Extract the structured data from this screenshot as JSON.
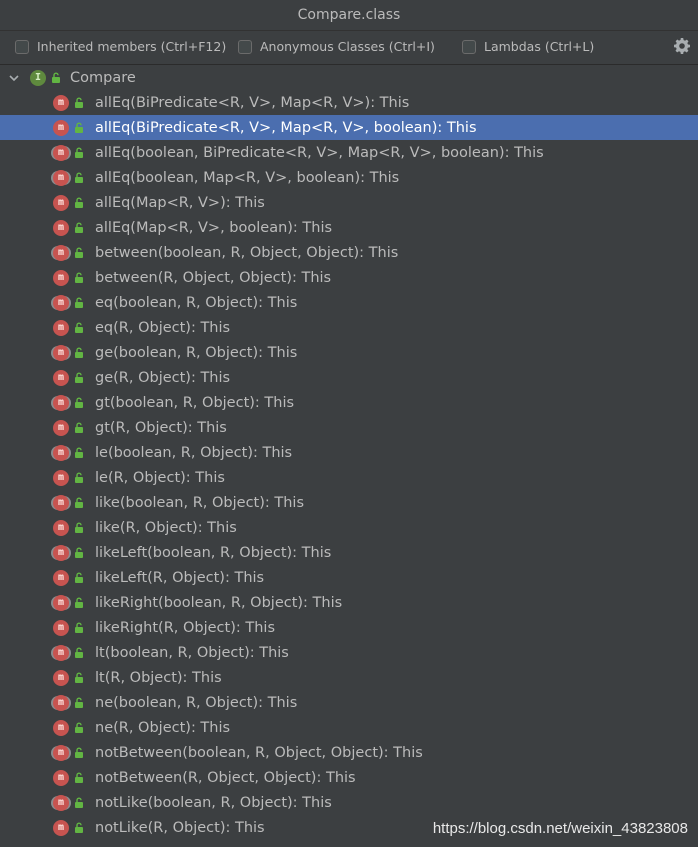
{
  "window": {
    "title": "Compare.class"
  },
  "toolbar": {
    "inherited_label": "Inherited members (Ctrl+F12)",
    "anonymous_label": "Anonymous Classes (Ctrl+I)",
    "lambdas_label": "Lambdas (Ctrl+L)"
  },
  "tree": {
    "root_label": "Compare",
    "methods": [
      "allEq(BiPredicate<R, V>, Map<R, V>): This",
      "allEq(BiPredicate<R, V>, Map<R, V>, boolean): This",
      "allEq(boolean, BiPredicate<R, V>, Map<R, V>, boolean): This",
      "allEq(boolean, Map<R, V>, boolean): This",
      "allEq(Map<R, V>): This",
      "allEq(Map<R, V>, boolean): This",
      "between(boolean, R, Object, Object): This",
      "between(R, Object, Object): This",
      "eq(boolean, R, Object): This",
      "eq(R, Object): This",
      "ge(boolean, R, Object): This",
      "ge(R, Object): This",
      "gt(boolean, R, Object): This",
      "gt(R, Object): This",
      "le(boolean, R, Object): This",
      "le(R, Object): This",
      "like(boolean, R, Object): This",
      "like(R, Object): This",
      "likeLeft(boolean, R, Object): This",
      "likeLeft(R, Object): This",
      "likeRight(boolean, R, Object): This",
      "likeRight(R, Object): This",
      "lt(boolean, R, Object): This",
      "lt(R, Object): This",
      "ne(boolean, R, Object): This",
      "ne(R, Object): This",
      "notBetween(boolean, R, Object, Object): This",
      "notBetween(R, Object, Object): This",
      "notLike(boolean, R, Object): This",
      "notLike(R, Object): This"
    ],
    "overridden_flags": [
      false,
      false,
      true,
      true,
      false,
      false,
      true,
      false,
      true,
      false,
      true,
      false,
      true,
      false,
      true,
      false,
      true,
      false,
      true,
      false,
      true,
      false,
      true,
      false,
      true,
      false,
      true,
      false,
      true,
      false
    ],
    "selected_index": 1,
    "method_icon_letter": "m",
    "interface_icon_letter": "I"
  },
  "watermark": "https://blog.csdn.net/weixin_43823808",
  "colors": {
    "background": "#3c3f41",
    "selection": "#4b6eaf",
    "method_icon": "#c75450",
    "interface_icon": "#5f8a3e",
    "lock_green": "#62b543"
  }
}
